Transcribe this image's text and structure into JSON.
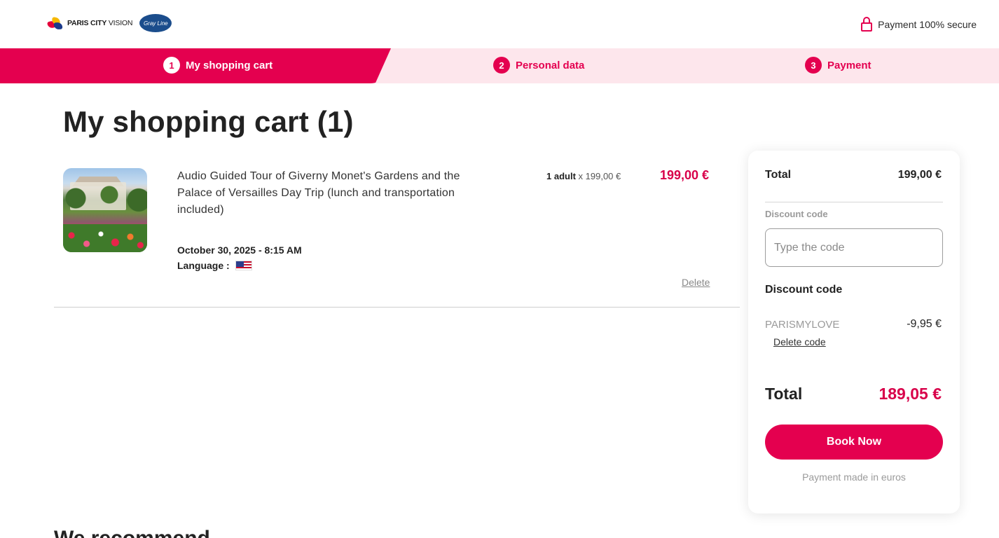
{
  "header": {
    "logo_bold": "PARIS CITY",
    "logo_light": "VISION",
    "partner_logo": "Gray Line",
    "secure_text": "Payment 100% secure"
  },
  "steps": [
    {
      "number": "1",
      "label": "My shopping cart",
      "active": true
    },
    {
      "number": "2",
      "label": "Personal data",
      "active": false
    },
    {
      "number": "3",
      "label": "Payment",
      "active": false
    }
  ],
  "page": {
    "title": "My shopping cart (1)",
    "bottom_heading": "We recommend"
  },
  "cart_item": {
    "title": "Audio Guided Tour of Giverny Monet's Gardens and the Palace of Versailles Day Trip (lunch and transportation included)",
    "date": "October 30, 2025 - 8:15 AM",
    "language_label": "Language :",
    "language_flag": "us-flag-icon",
    "qty_label": "1 adult",
    "qty_unit_price": "x 199,00 €",
    "price": "199,00 €",
    "delete_label": "Delete"
  },
  "summary": {
    "total_label": "Total",
    "total_value": "199,00 €",
    "discount_label": "Discount code",
    "discount_placeholder": "Type the code",
    "applied_title": "Discount code",
    "applied_code": "PARISMYLOVE",
    "applied_amount": "-9,95 €",
    "delete_code_label": "Delete code",
    "grand_total_label": "Total",
    "grand_total_value": "189,05 €",
    "book_label": "Book Now",
    "note": "Payment made in euros"
  },
  "colors": {
    "accent": "#e4004f",
    "accent_light": "#fde6ec",
    "price": "#d8004a"
  }
}
